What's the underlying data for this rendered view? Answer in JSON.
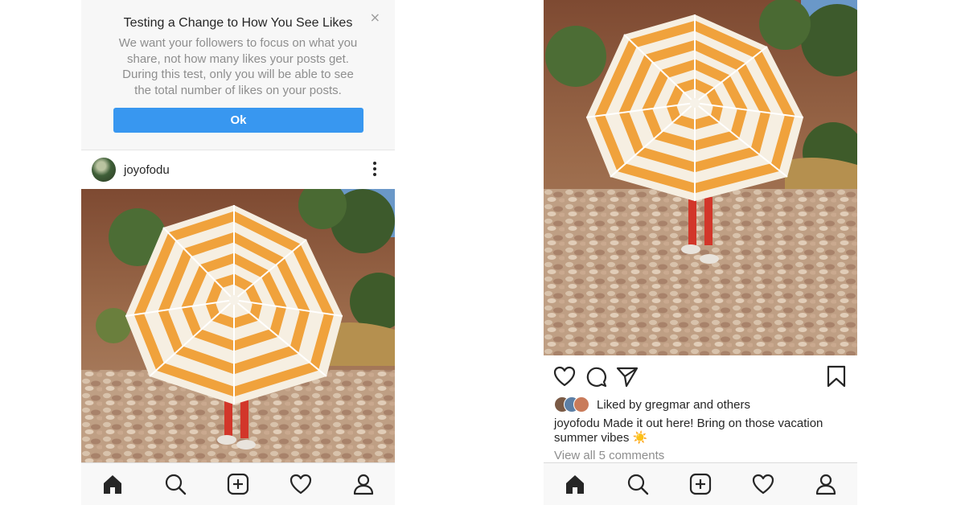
{
  "left_screen": {
    "notice": {
      "title": "Testing a Change to How You See Likes",
      "close_glyph": "×",
      "body": "We want your followers to focus on what you share, not how many likes your posts get. During this test, only you will be able to see the total number of likes on your posts.",
      "ok_label": "Ok"
    },
    "post": {
      "username": "joyofodu",
      "more_icon": "more-vertical-icon"
    }
  },
  "right_screen": {
    "actions": {
      "like_icon": "heart-icon",
      "comment_icon": "comment-icon",
      "share_icon": "send-icon",
      "save_icon": "bookmark-icon"
    },
    "likes": {
      "prefix": "Liked by",
      "user": "gregmar",
      "conjunction": "and",
      "others": "others"
    },
    "caption": {
      "username": "joyofodu",
      "text": "Made it out here! Bring on those vacation summer vibes",
      "emoji": "☀️"
    },
    "view_comments": "View all 5 comments"
  },
  "bottom_nav": {
    "items": [
      "home-icon",
      "search-icon",
      "new-post-icon",
      "activity-heart-icon",
      "profile-icon"
    ]
  },
  "colors": {
    "accent_blue": "#3897f0",
    "umbrella_orange": "#f0a23c",
    "text_primary": "#262626",
    "text_secondary": "#8e8e8e"
  }
}
